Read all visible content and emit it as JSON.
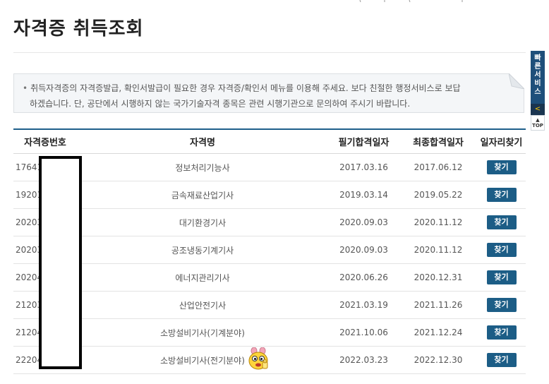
{
  "page": {
    "title": "자격증 취득조회"
  },
  "notice": {
    "line1": "취득자격증의 자격증발급, 확인서발급이 필요한 경우 자격증/확인서 메뉴를 이용해 주세요. 보다 친절한 행정서비스로 보답",
    "line2": "하겠습니다. 단, 공단에서 시행하지 않는 국가기술자격 종목은 관련 시행기관으로 문의하여 주시기 바랍니다."
  },
  "quick_menu": {
    "label_chars": [
      "빠",
      "른",
      "서",
      "비",
      "스"
    ],
    "arrow": "<",
    "top": "TOP"
  },
  "table": {
    "headers": [
      "자격증번호",
      "자격명",
      "필기합격일자",
      "최종합격일자",
      "일자리찾기"
    ],
    "button_label": "찾기",
    "rows": [
      {
        "no": "17641",
        "name": "정보처리기능사",
        "written": "2017.03.16",
        "final": "2017.06.12"
      },
      {
        "no": "19201",
        "name": "금속재료산업기사",
        "written": "2019.03.14",
        "final": "2019.05.22"
      },
      {
        "no": "20203",
        "name": "대기환경기사",
        "written": "2020.09.03",
        "final": "2020.11.12"
      },
      {
        "no": "20203",
        "name": "공조냉동기계기사",
        "written": "2020.09.03",
        "final": "2020.11.12"
      },
      {
        "no": "20204",
        "name": "에너지관리기사",
        "written": "2020.06.26",
        "final": "2020.12.31"
      },
      {
        "no": "21203",
        "name": "산업안전기사",
        "written": "2021.03.19",
        "final": "2021.11.26"
      },
      {
        "no": "21204",
        "name": "소방설비기사(기계분야)",
        "written": "2021.10.06",
        "final": "2021.12.24"
      },
      {
        "no": "22204",
        "name": "소방설비기사(전기분야)",
        "written": "2022.03.23",
        "final": "2022.12.30"
      }
    ]
  },
  "colors": {
    "accent": "#1f5f8b",
    "button": "#1c5d86",
    "quick_menu": "#1e4f7a"
  }
}
